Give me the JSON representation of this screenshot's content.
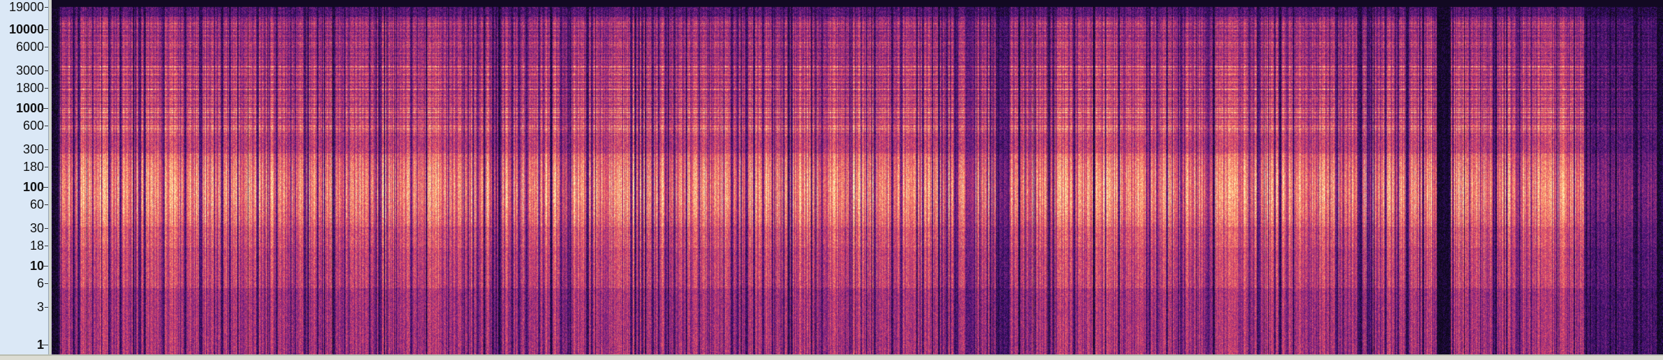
{
  "frequency_ruler": {
    "ticks": [
      {
        "label": "19000",
        "value": 19000,
        "major": false
      },
      {
        "label": "10000",
        "value": 10000,
        "major": true
      },
      {
        "label": "6000",
        "value": 6000,
        "major": false
      },
      {
        "label": "3000",
        "value": 3000,
        "major": false
      },
      {
        "label": "1800",
        "value": 1800,
        "major": false
      },
      {
        "label": "1000",
        "value": 1000,
        "major": true
      },
      {
        "label": "600",
        "value": 600,
        "major": false
      },
      {
        "label": "300",
        "value": 300,
        "major": false
      },
      {
        "label": "180",
        "value": 180,
        "major": false
      },
      {
        "label": "100",
        "value": 100,
        "major": true
      },
      {
        "label": "60",
        "value": 60,
        "major": false
      },
      {
        "label": "30",
        "value": 30,
        "major": false
      },
      {
        "label": "18",
        "value": 18,
        "major": false
      },
      {
        "label": "10",
        "value": 10,
        "major": true
      },
      {
        "label": "6",
        "value": 6,
        "major": false
      },
      {
        "label": "3",
        "value": 3,
        "major": false
      },
      {
        "label": "1",
        "value": 1,
        "major": true
      }
    ]
  },
  "spectrogram": {
    "scale": "logarithmic",
    "colormap": [
      "#0d0819",
      "#3b0f70",
      "#8c2981",
      "#de4968",
      "#fe9f6d",
      "#fcfdbf"
    ]
  }
}
